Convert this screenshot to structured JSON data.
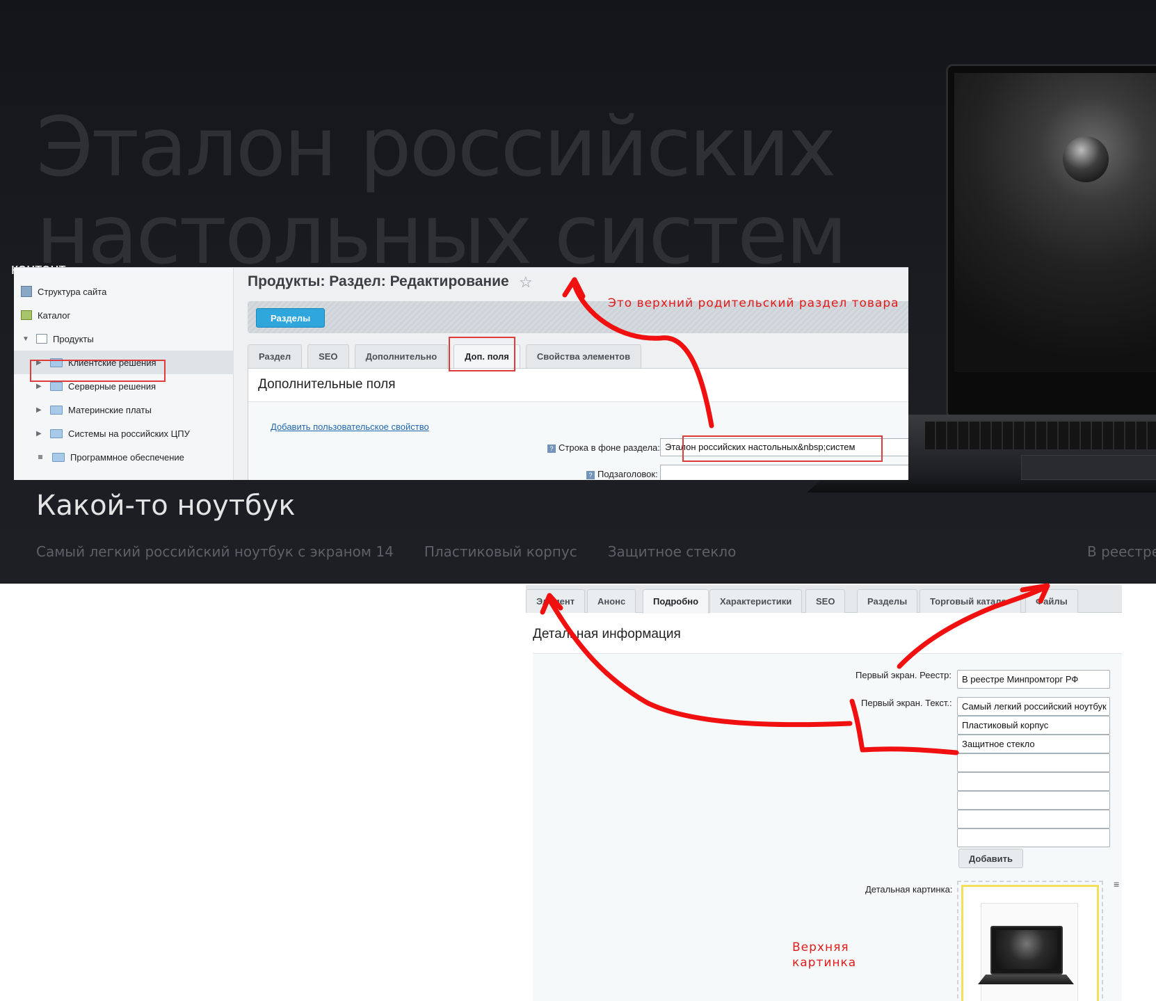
{
  "hero": {
    "bg_title_line1": "Эталон российских",
    "bg_title_line2": "настольных систем",
    "cut_label": "контент",
    "product_title": "Какой-то ноутбук",
    "features": [
      "Самый легкий российский ноутбук с экраном 14",
      "Пластиковый корпус",
      "Защитное стекло"
    ],
    "registry": "В реестре"
  },
  "admin_section": {
    "tree": {
      "items": [
        {
          "label": "Структура сайта"
        },
        {
          "label": "Каталог"
        },
        {
          "label": "Продукты"
        },
        {
          "label": "Клиентские решения"
        },
        {
          "label": "Серверные решения"
        },
        {
          "label": "Материнские платы"
        },
        {
          "label": "Системы на российских ЦПУ"
        },
        {
          "label": "Программное обеспечение"
        }
      ]
    },
    "page_title": "Продукты: Раздел: Редактирование",
    "sections_button": "Разделы",
    "tabs": [
      "Раздел",
      "SEO",
      "Дополнительно",
      "Доп. поля",
      "Свойства элементов"
    ],
    "panel_title": "Дополнительные поля",
    "add_property_link": "Добавить пользовательское свойство",
    "field_label": "Строка в фоне раздела:",
    "field_value": "Эталон российских настольных&nbsp;систем",
    "next_field_label": "Подзаголовок:"
  },
  "admin_element": {
    "tabs": [
      "Элемент",
      "Анонс",
      "Подробно",
      "Характеристики",
      "SEO",
      "Разделы",
      "Торговый каталог",
      "Файлы"
    ],
    "panel_title": "Детальная информация",
    "registry_label": "Первый экран. Реестр:",
    "registry_value": "В реестре Минпромторг РФ",
    "text_label": "Первый экран. Текст.:",
    "text_values": [
      "Самый легкий российский ноутбук",
      "Пластиковый корпус",
      "Защитное стекло",
      "",
      "",
      "",
      "",
      ""
    ],
    "add_button": "Добавить",
    "detail_picture_label": "Детальная картинка:",
    "side_icon": "≡"
  },
  "annotations": {
    "section_note": "Это верхний родительский раздел товара",
    "picture_note_line1": "Верхняя",
    "picture_note_line2": "картинка",
    "color": "#e21b1b"
  },
  "icons": {
    "star": "☆",
    "arrow_right": "▶",
    "arrow_down": "▼",
    "hint": "?"
  }
}
